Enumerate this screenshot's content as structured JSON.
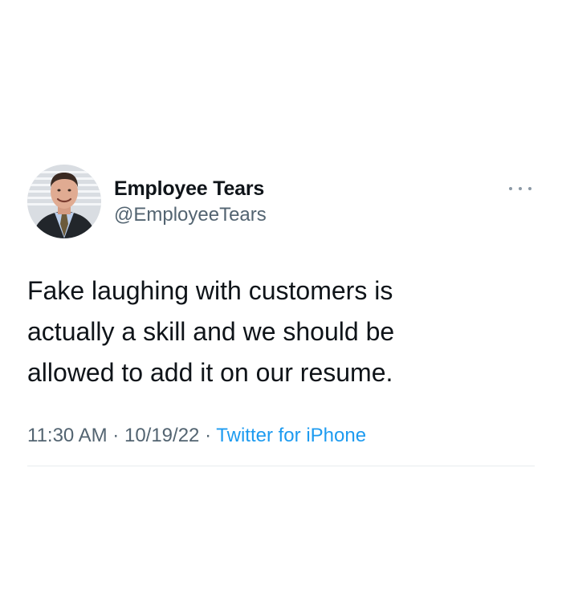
{
  "tweet": {
    "author": {
      "display_name": "Employee Tears",
      "handle": "@EmployeeTears",
      "avatar_icon": "profile-photo"
    },
    "more_icon": "more-dots-icon",
    "text": "Fake laughing with customers is\nactually a skill and we should be\nallowed to add it on our resume.",
    "time": "11:30 AM",
    "separator_1": "·",
    "date": "10/19/22",
    "separator_2": "·",
    "source": "Twitter for iPhone"
  },
  "colors": {
    "text_primary": "#0f1419",
    "text_secondary": "#536471",
    "link": "#1d9bf0",
    "divider": "#e8ecef"
  }
}
